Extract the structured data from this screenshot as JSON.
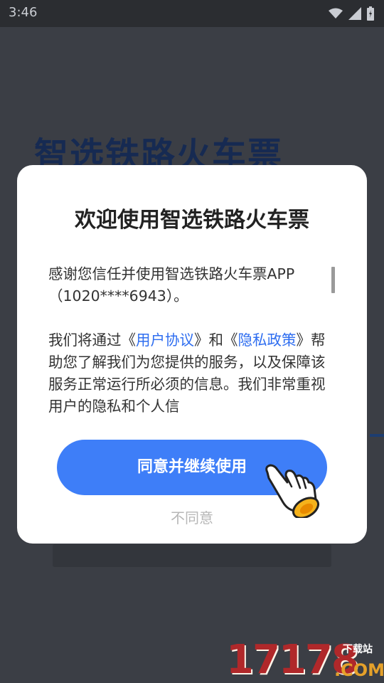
{
  "status_bar": {
    "time": "3:46",
    "icons": [
      "wifi-icon",
      "signal-icon",
      "battery-icon"
    ]
  },
  "background": {
    "app_title": "智选铁路火车票"
  },
  "dialog": {
    "title": "欢迎使用智选铁路火车票",
    "intro": "感谢您信任并使用智选铁路火车票APP（1020****6943）。",
    "para_prefix": "我们将通过《",
    "user_agreement_link": "用户协议",
    "para_mid": "》和《",
    "privacy_policy_link": "隐私政策",
    "para_suffix": "》帮助您了解我们为您提供的服务，以及保障该服务正常运行所必须的信息。我们非常重视用户的隐私和个人信",
    "agree_label": "同意并继续使用",
    "disagree_label": "不同意"
  },
  "watermark": {
    "digits": "17178",
    "tag": "下载站",
    "domain": ".COM"
  },
  "colors": {
    "accent": "#3e7ef8",
    "link": "#2f6ef0",
    "overlay_bg": "#3b3e45",
    "watermark_red": "#b0282a",
    "watermark_gold": "#e5a12a"
  }
}
